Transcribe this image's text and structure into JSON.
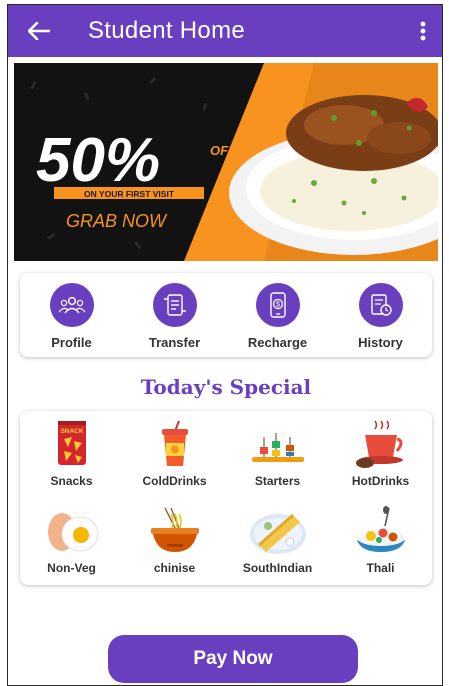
{
  "appbar": {
    "title": "Student Home",
    "back_icon": "arrow-left-icon",
    "menu_icon": "more-vertical-icon"
  },
  "banner": {
    "discount": "50%",
    "discount_suffix": "OFF",
    "subtitle": "ON YOUR FIRST VISIT",
    "cta": "GRAB NOW"
  },
  "services": [
    {
      "label": "Profile",
      "icon": "users-icon"
    },
    {
      "label": "Transfer",
      "icon": "transfer-icon"
    },
    {
      "label": "Recharge",
      "icon": "recharge-icon"
    },
    {
      "label": "History",
      "icon": "history-icon"
    }
  ],
  "special": {
    "title": "Today's Special",
    "items": [
      {
        "label": "Snacks",
        "icon": "snack-icon"
      },
      {
        "label": "ColdDrinks",
        "icon": "cold-drink-icon"
      },
      {
        "label": "Starters",
        "icon": "starters-icon"
      },
      {
        "label": "HotDrinks",
        "icon": "hot-drink-icon"
      },
      {
        "label": "Non-Veg",
        "icon": "egg-icon"
      },
      {
        "label": "chinise",
        "icon": "noodles-icon"
      },
      {
        "label": "SouthIndian",
        "icon": "dosa-icon"
      },
      {
        "label": "Thali",
        "icon": "thali-icon"
      }
    ],
    "snack_pack_text": "SNACK"
  },
  "pay_button": {
    "label": "Pay Now"
  },
  "colors": {
    "primary": "#6a3fbf",
    "accent": "#f7931e"
  }
}
